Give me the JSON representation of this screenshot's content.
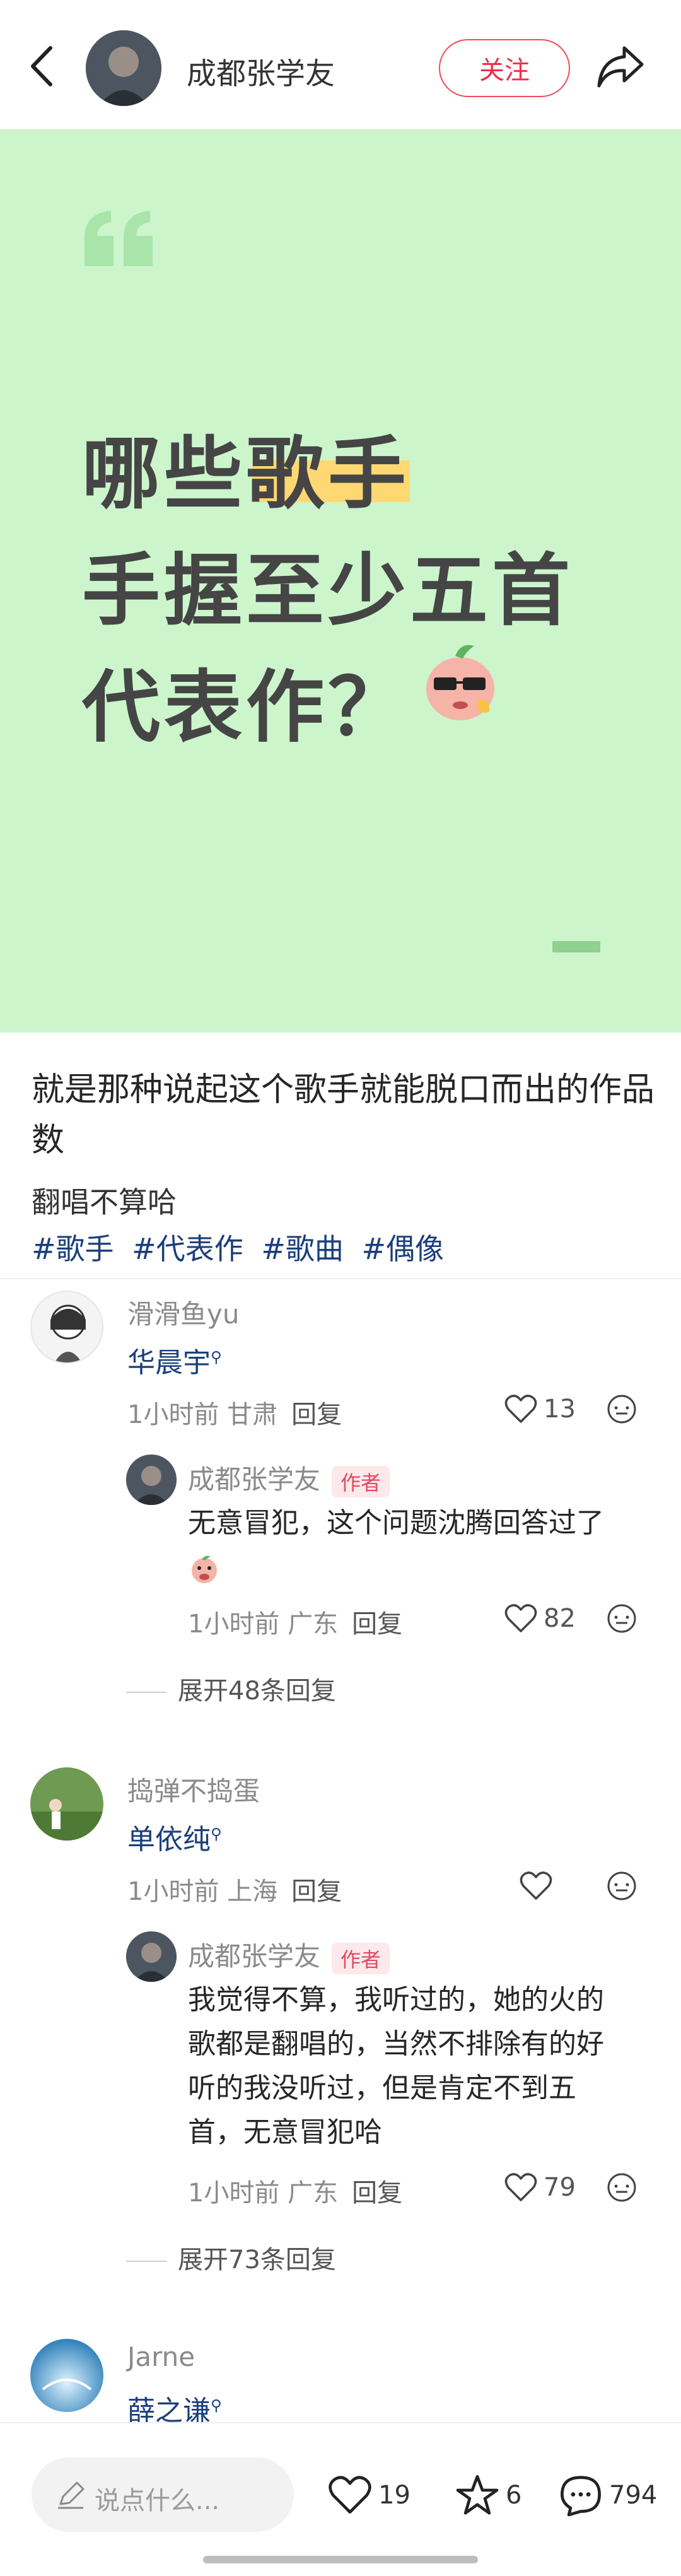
{
  "header": {
    "author_name": "成都张学友",
    "follow_label": "关注"
  },
  "cover": {
    "lines": [
      "哪些歌手",
      "手握至少五首",
      "代表作？"
    ],
    "bg_color": "#ccf5cc",
    "highlight_color": "#ffd873"
  },
  "post": {
    "title": "就是那种说起这个歌手就能脱口而出的作品数",
    "description": "翻唱不算哈",
    "tags": [
      "#歌手",
      "#代表作",
      "#歌曲",
      "#偶像"
    ]
  },
  "comments": [
    {
      "user": "滑滑鱼yu",
      "text": "华晨宇",
      "time": "1小时前",
      "location": "甘肃",
      "reply_label": "回复",
      "likes": "13",
      "reply": {
        "user": "成都张学友",
        "badge": "作者",
        "text": "无意冒犯，这个问题沈腾回答过了",
        "time": "1小时前",
        "location": "广东",
        "reply_label": "回复",
        "likes": "82"
      },
      "expand_label": "展开48条回复"
    },
    {
      "user": "捣弹不捣蛋",
      "text": "单依纯",
      "time": "1小时前",
      "location": "上海",
      "reply_label": "回复",
      "likes": "",
      "reply": {
        "user": "成都张学友",
        "badge": "作者",
        "text_lines": [
          "我觉得不算，我听过的，她的火的",
          "歌都是翻唱的，当然不排除有的好",
          "听的我没听过，但是肯定不到五",
          "首，无意冒犯哈"
        ],
        "time": "1小时前",
        "location": "广东",
        "reply_label": "回复",
        "likes": "79"
      },
      "expand_label": "展开73条回复"
    },
    {
      "user": "Jarne",
      "text": "薛之谦"
    }
  ],
  "bottom_bar": {
    "input_placeholder": "说点什么...",
    "likes": "19",
    "favorites": "6",
    "comments": "794"
  }
}
